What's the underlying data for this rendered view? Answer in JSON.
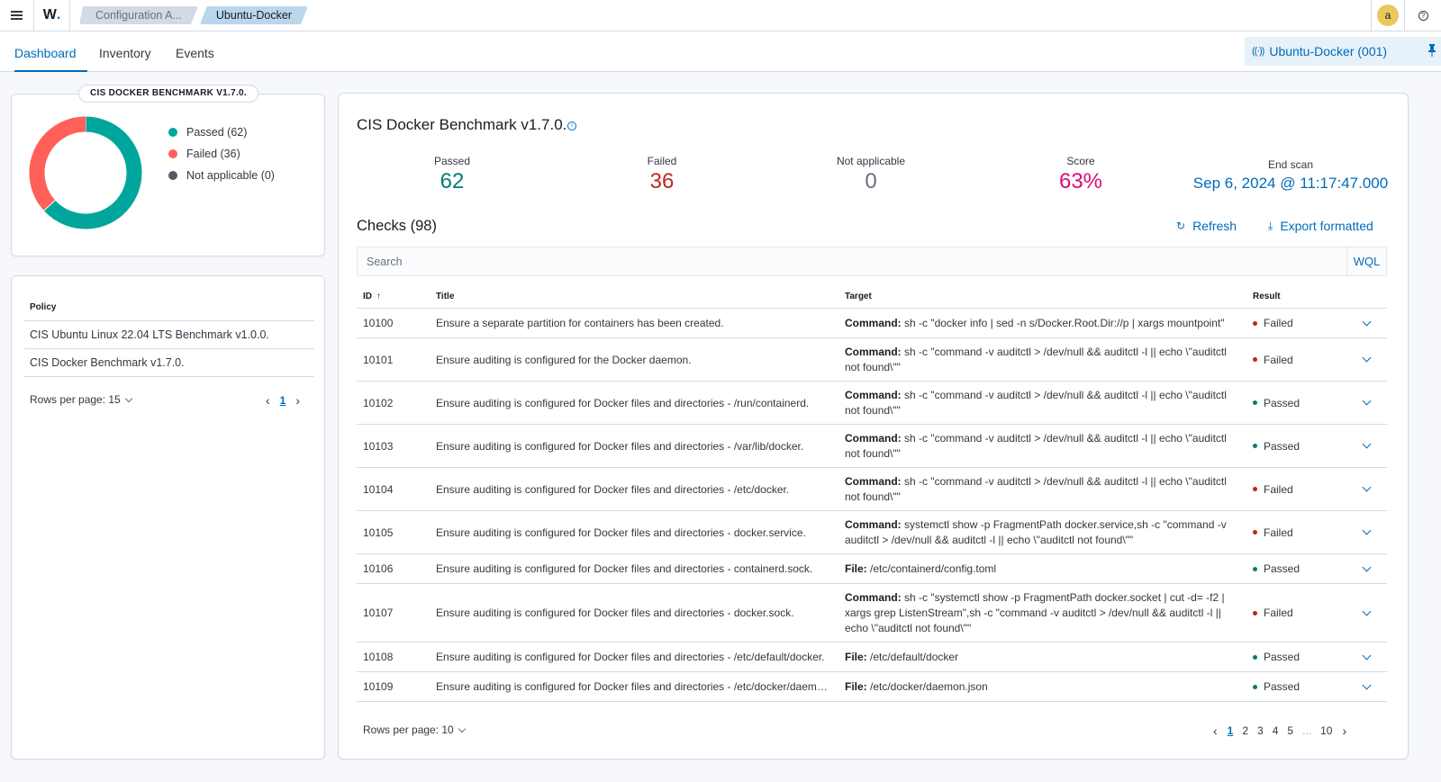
{
  "header": {
    "logo": "W",
    "breadcrumbs": [
      "Configuration A...",
      "Ubuntu-Docker"
    ],
    "avatar_letter": "a",
    "help": "?"
  },
  "tabs": [
    {
      "label": "Dashboard",
      "active": true
    },
    {
      "label": "Inventory",
      "active": false
    },
    {
      "label": "Events",
      "active": false
    }
  ],
  "agent_pill": "Ubuntu-Docker (001)",
  "donut": {
    "title": "CIS DOCKER BENCHMARK V1.7.0.",
    "legend": [
      {
        "label": "Passed (62)",
        "color": "#00a69b"
      },
      {
        "label": "Failed (36)",
        "color": "#ff6058"
      },
      {
        "label": "Not applicable (0)",
        "color": "#535966"
      }
    ]
  },
  "chart_data": {
    "type": "pie",
    "title": "CIS DOCKER BENCHMARK V1.7.0.",
    "categories": [
      "Passed",
      "Failed",
      "Not applicable"
    ],
    "values": [
      62,
      36,
      0
    ],
    "colors": [
      "#00a69b",
      "#ff6058",
      "#535966"
    ],
    "legend_position": "right"
  },
  "policies": {
    "header": "Policy",
    "rows": [
      "CIS Ubuntu Linux 22.04 LTS Benchmark v1.0.0.",
      "CIS Docker Benchmark v1.7.0."
    ],
    "rows_per_page": "Rows per page: 15",
    "pages": [
      "1"
    ],
    "current_page": "1"
  },
  "main": {
    "title": "CIS Docker Benchmark v1.7.0.",
    "stats": {
      "passed_label": "Passed",
      "passed": "62",
      "passed_color": "#017d73",
      "failed_label": "Failed",
      "failed": "36",
      "failed_color": "#bd271e",
      "na_label": "Not applicable",
      "na": "0",
      "na_color": "#69707d",
      "score_label": "Score",
      "score": "63%",
      "score_color": "#dd0a73",
      "end_scan_label": "End scan",
      "end_scan": "Sep 6, 2024 @ 11:17:47.000"
    },
    "checks_title": "Checks (98)",
    "refresh": "Refresh",
    "export": "Export formatted",
    "search_placeholder": "Search",
    "wql": "WQL",
    "columns": {
      "id": "ID",
      "title": "Title",
      "target": "Target",
      "result": "Result"
    },
    "rows": [
      {
        "id": "10100",
        "title": "Ensure a separate partition for containers has been created.",
        "target_label": "Command:",
        "target": " sh -c \"docker info | sed -n s/Docker.Root.Dir://p | xargs mountpoint\"",
        "result": "Failed"
      },
      {
        "id": "10101",
        "title": "Ensure auditing is configured for the Docker daemon.",
        "target_label": "Command:",
        "target": " sh -c \"command -v auditctl > /dev/null && auditctl -l || echo \\\"auditctl not found\\\"\"",
        "result": "Failed"
      },
      {
        "id": "10102",
        "title": "Ensure auditing is configured for Docker files and directories - /run/containerd.",
        "target_label": "Command:",
        "target": " sh -c \"command -v auditctl > /dev/null && auditctl -l || echo \\\"auditctl not found\\\"\"",
        "result": "Passed"
      },
      {
        "id": "10103",
        "title": "Ensure auditing is configured for Docker files and directories - /var/lib/docker.",
        "target_label": "Command:",
        "target": " sh -c \"command -v auditctl > /dev/null && auditctl -l || echo \\\"auditctl not found\\\"\"",
        "result": "Passed"
      },
      {
        "id": "10104",
        "title": "Ensure auditing is configured for Docker files and directories - /etc/docker.",
        "target_label": "Command:",
        "target": " sh -c \"command -v auditctl > /dev/null && auditctl -l || echo \\\"auditctl not found\\\"\"",
        "result": "Failed"
      },
      {
        "id": "10105",
        "title": "Ensure auditing is configured for Docker files and directories - docker.service.",
        "target_label": "Command:",
        "target": " systemctl show -p FragmentPath docker.service,sh -c \"command -v auditctl > /dev/null && auditctl -l || echo \\\"auditctl not found\\\"\"",
        "result": "Failed"
      },
      {
        "id": "10106",
        "title": "Ensure auditing is configured for Docker files and directories - containerd.sock.",
        "target_label": "File:",
        "target": " /etc/containerd/config.toml",
        "result": "Passed"
      },
      {
        "id": "10107",
        "title": "Ensure auditing is configured for Docker files and directories - docker.sock.",
        "target_label": "Command:",
        "target": " sh -c \"systemctl show -p FragmentPath docker.socket | cut -d= -f2 | xargs grep ListenStream\",sh -c \"command -v auditctl > /dev/null && auditctl -l || echo \\\"auditctl not found\\\"\"",
        "result": "Failed"
      },
      {
        "id": "10108",
        "title": "Ensure auditing is configured for Docker files and directories - /etc/default/docker.",
        "target_label": "File:",
        "target": " /etc/default/docker",
        "result": "Passed"
      },
      {
        "id": "10109",
        "title": "Ensure auditing is configured for Docker files and directories - /etc/docker/daemon.json.",
        "target_label": "File:",
        "target": " /etc/docker/daemon.json",
        "result": "Passed"
      }
    ],
    "result_colors": {
      "Passed": "#017d73",
      "Failed": "#bd271e"
    },
    "rows_per_page": "Rows per page: 10",
    "pages": [
      "1",
      "2",
      "3",
      "4",
      "5",
      "...",
      "10"
    ],
    "current_page": "1"
  }
}
